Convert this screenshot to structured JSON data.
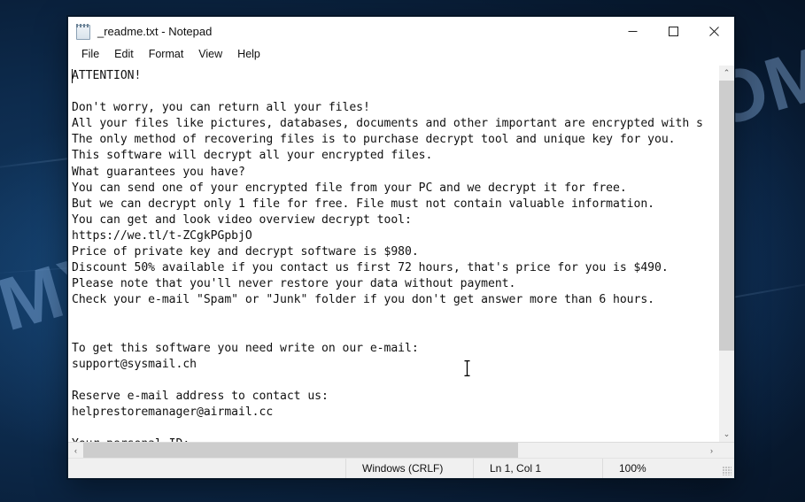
{
  "desktop": {
    "watermark": "MYANTISPYWARE.COM"
  },
  "window": {
    "title": "_readme.txt - Notepad",
    "icon": "notepad-icon",
    "controls": {
      "minimize": "minimize-button",
      "maximize": "maximize-button",
      "close": "close-button"
    },
    "menu": [
      {
        "label": "File"
      },
      {
        "label": "Edit"
      },
      {
        "label": "Format"
      },
      {
        "label": "View"
      },
      {
        "label": "Help"
      }
    ],
    "document": {
      "filename": "_readme.txt",
      "lines": [
        "ATTENTION!",
        "",
        "Don't worry, you can return all your files!",
        "All your files like pictures, databases, documents and other important are encrypted with s",
        "The only method of recovering files is to purchase decrypt tool and unique key for you.",
        "This software will decrypt all your encrypted files.",
        "What guarantees you have?",
        "You can send one of your encrypted file from your PC and we decrypt it for free.",
        "But we can decrypt only 1 file for free. File must not contain valuable information.",
        "You can get and look video overview decrypt tool:",
        "https://we.tl/t-ZCgkPGpbjO",
        "Price of private key and decrypt software is $980.",
        "Discount 50% available if you contact us first 72 hours, that's price for you is $490.",
        "Please note that you'll never restore your data without payment.",
        "Check your e-mail \"Spam\" or \"Junk\" folder if you don't get answer more than 6 hours.",
        "",
        "",
        "To get this software you need write on our e-mail:",
        "support@sysmail.ch",
        "",
        "Reserve e-mail address to contact us:",
        "helprestoremanager@airmail.cc",
        "",
        "Your personal ID:"
      ],
      "ransom_details": {
        "price_full": "$980",
        "price_discount": "$490",
        "discount_percent": "50%",
        "discount_window_hours": "72",
        "response_time_hours": "6",
        "free_decrypt_files": "1",
        "video_url": "https://we.tl/t-ZCgkPGpbjO",
        "primary_email": "support@sysmail.ch",
        "reserve_email": "helprestoremanager@airmail.cc"
      }
    },
    "statusbar": {
      "encoding": "Windows (CRLF)",
      "position": "Ln 1, Col 1",
      "zoom": "100%"
    },
    "scrollbars": {
      "vertical_up": "⌃",
      "vertical_down": "⌄",
      "horizontal_left": "‹",
      "horizontal_right": "›"
    }
  },
  "colors": {
    "desktop_base": "#0d2b4d",
    "watermark": "#96c0f2",
    "window_chrome": "#ffffff",
    "editor_bg": "#ffffff",
    "editor_text": "#111111",
    "statusbar_bg": "#f0f0f0",
    "scrollbar_thumb": "#cdcdcd",
    "close_hover": "#e81123"
  }
}
